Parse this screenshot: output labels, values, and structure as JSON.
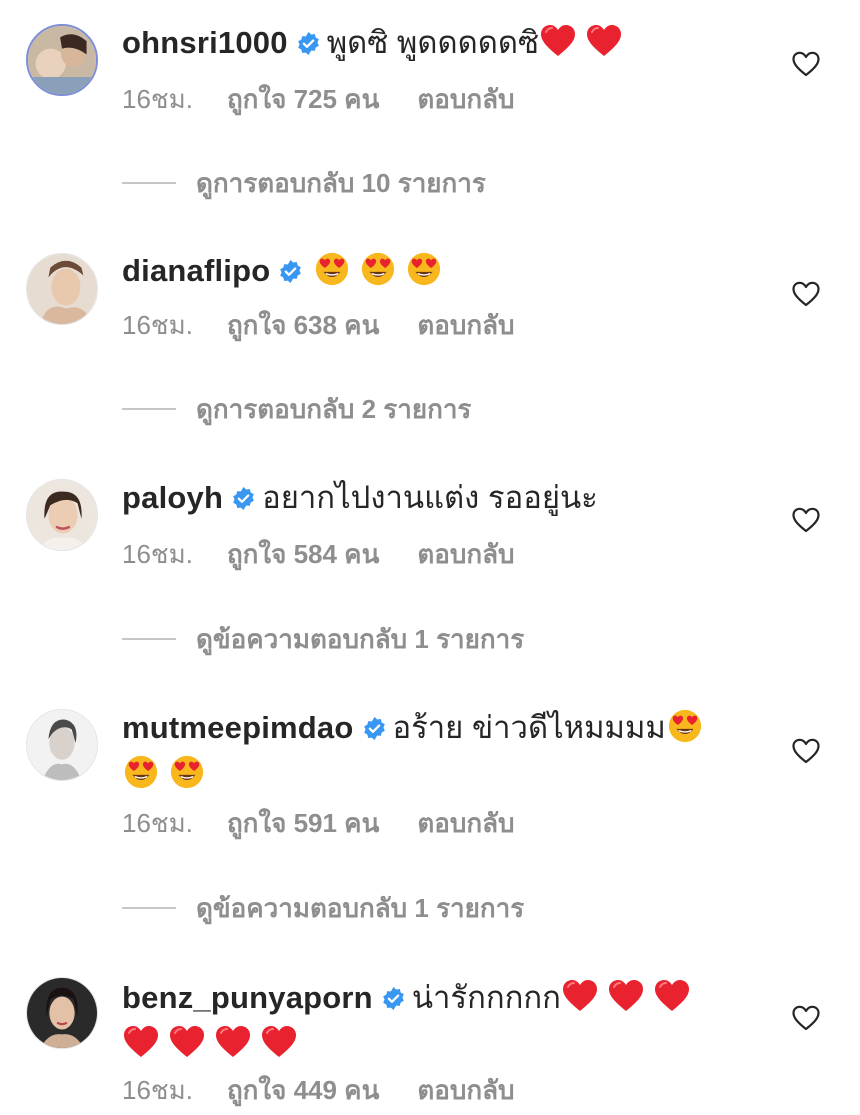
{
  "comments": [
    {
      "username": "ohnsri1000",
      "text": "พูดซิ พูดดดดดซิ",
      "text_emojis": [
        "heart",
        "heart"
      ],
      "wrap_emojis": [],
      "time": "16ชม.",
      "likes": "ถูกใจ 725 คน",
      "reply": "ตอบกลับ",
      "view_replies": "ดูการตอบกลับ 10 รายการ"
    },
    {
      "username": "dianaflipo",
      "text": "",
      "text_emojis": [
        "heart-eyes",
        "heart-eyes",
        "heart-eyes"
      ],
      "wrap_emojis": [],
      "time": "16ชม.",
      "likes": "ถูกใจ 638 คน",
      "reply": "ตอบกลับ",
      "view_replies": "ดูการตอบกลับ 2 รายการ"
    },
    {
      "username": "paloyh",
      "text": "อยากไปงานแต่ง รออยู่นะ",
      "text_emojis": [],
      "wrap_emojis": [],
      "time": "16ชม.",
      "likes": "ถูกใจ 584 คน",
      "reply": "ตอบกลับ",
      "view_replies": "ดูข้อความตอบกลับ 1 รายการ"
    },
    {
      "username": "mutmeepimdao",
      "text": "อร้าย ข่าวดีไหมมมม",
      "text_emojis": [
        "heart-eyes"
      ],
      "wrap_emojis": [
        "heart-eyes",
        "heart-eyes"
      ],
      "time": "16ชม.",
      "likes": "ถูกใจ 591 คน",
      "reply": "ตอบกลับ",
      "view_replies": "ดูข้อความตอบกลับ 1 รายการ"
    },
    {
      "username": "benz_punyaporn",
      "text": "น่ารักกกกก",
      "text_emojis": [
        "heart",
        "heart",
        "heart"
      ],
      "wrap_emojis": [
        "heart",
        "heart",
        "heart",
        "heart"
      ],
      "time": "16ชม.",
      "likes": "ถูกใจ 449 คน",
      "reply": "ตอบกลับ",
      "view_replies": ""
    }
  ],
  "icons": {
    "verified": "verified-badge-icon",
    "like": "heart-outline-icon",
    "emoji_heart": "red-heart-emoji",
    "emoji_heart_eyes": "heart-eyes-emoji"
  },
  "colors": {
    "text": "#262626",
    "secondary": "#8e8e8e",
    "verified": "#3897f0",
    "heart": "#e8222e",
    "emoji_face": "#f7b71d"
  }
}
